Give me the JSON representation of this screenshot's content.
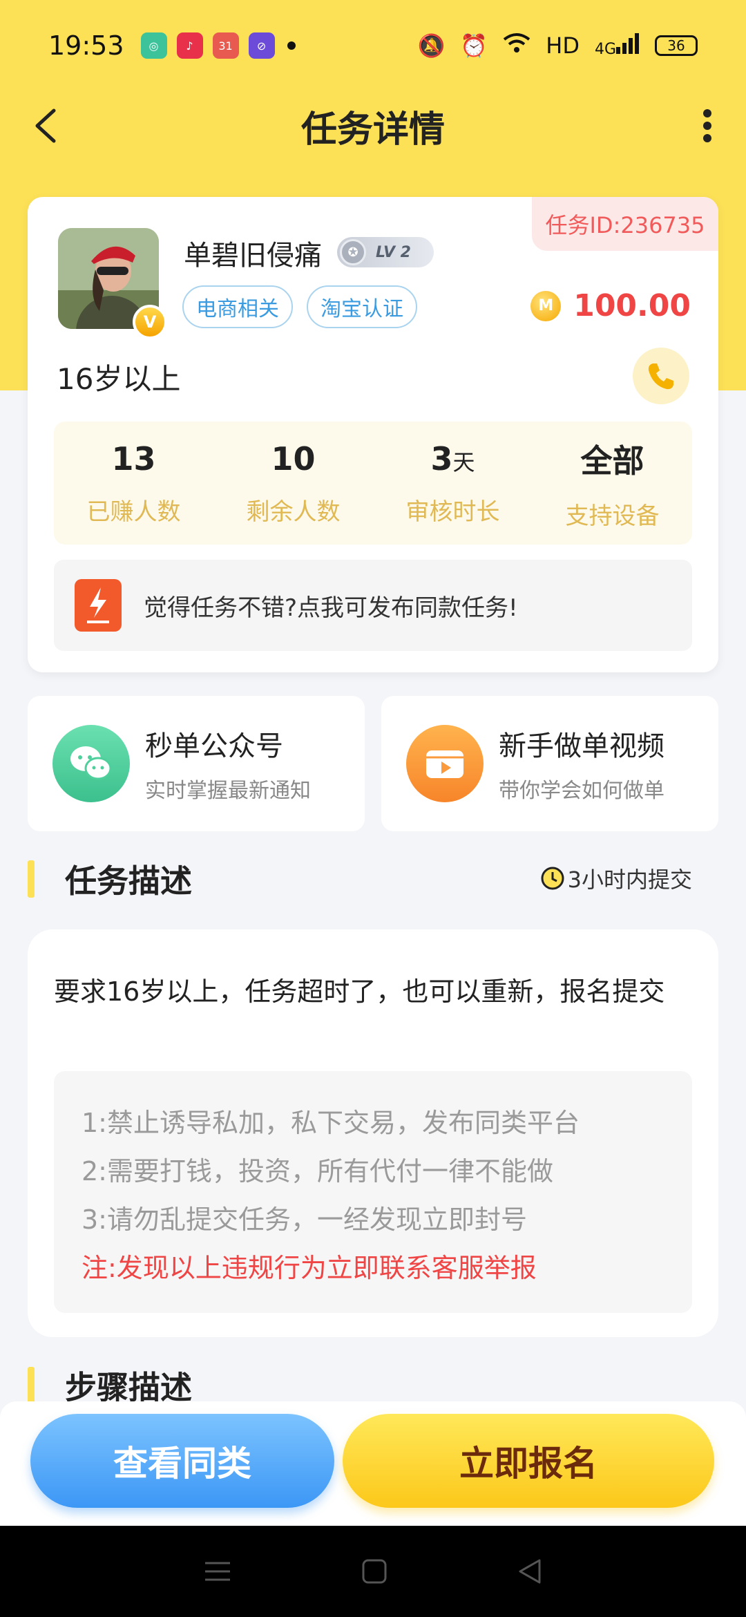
{
  "status_bar": {
    "time": "19:53",
    "network": "HD",
    "cell": "4G",
    "battery": "36"
  },
  "header": {
    "title": "任务详情"
  },
  "task": {
    "id_label": "任务ID:236735",
    "username": "单碧旧侵痛",
    "level": "LV 2",
    "vip_badge": "V",
    "tags": [
      "电商相关",
      "淘宝认证"
    ],
    "coin_symbol": "M",
    "reward": "100.00",
    "age_requirement": "16岁以上",
    "stats": [
      {
        "value": "13",
        "unit": "",
        "label": "已赚人数"
      },
      {
        "value": "10",
        "unit": "",
        "label": "剩余人数"
      },
      {
        "value": "3",
        "unit": "天",
        "label": "审核时长"
      },
      {
        "value": "全部",
        "unit": "",
        "label": "支持设备"
      }
    ],
    "publish_banner": "觉得任务不错?点我可发布同款任务!"
  },
  "cards": [
    {
      "title": "秒单公众号",
      "subtitle": "实时掌握最新通知",
      "icon": "wechat-icon",
      "color": "#4fcf9b"
    },
    {
      "title": "新手做单视频",
      "subtitle": "带你学会如何做单",
      "icon": "video-icon",
      "color": "#fb9a3c"
    }
  ],
  "description": {
    "section_title": "任务描述",
    "deadline": "3小时内提交",
    "text": "要求16岁以上，任务超时了，也可以重新，报名提交",
    "rules": [
      "1:禁止诱导私加，私下交易，发布同类平台",
      "2:需要打钱，投资，所有代付一律不能做",
      "3:请勿乱提交任务，一经发现立即封号"
    ],
    "warning": "注:发现以上违规行为立即联系客服举报"
  },
  "steps": {
    "section_title": "步骤描述"
  },
  "actions": {
    "similar": "查看同类",
    "signup": "立即报名"
  },
  "colors": {
    "brand_yellow": "#fce157",
    "reward_red": "#f04545",
    "tag_blue": "#3a9be0"
  }
}
